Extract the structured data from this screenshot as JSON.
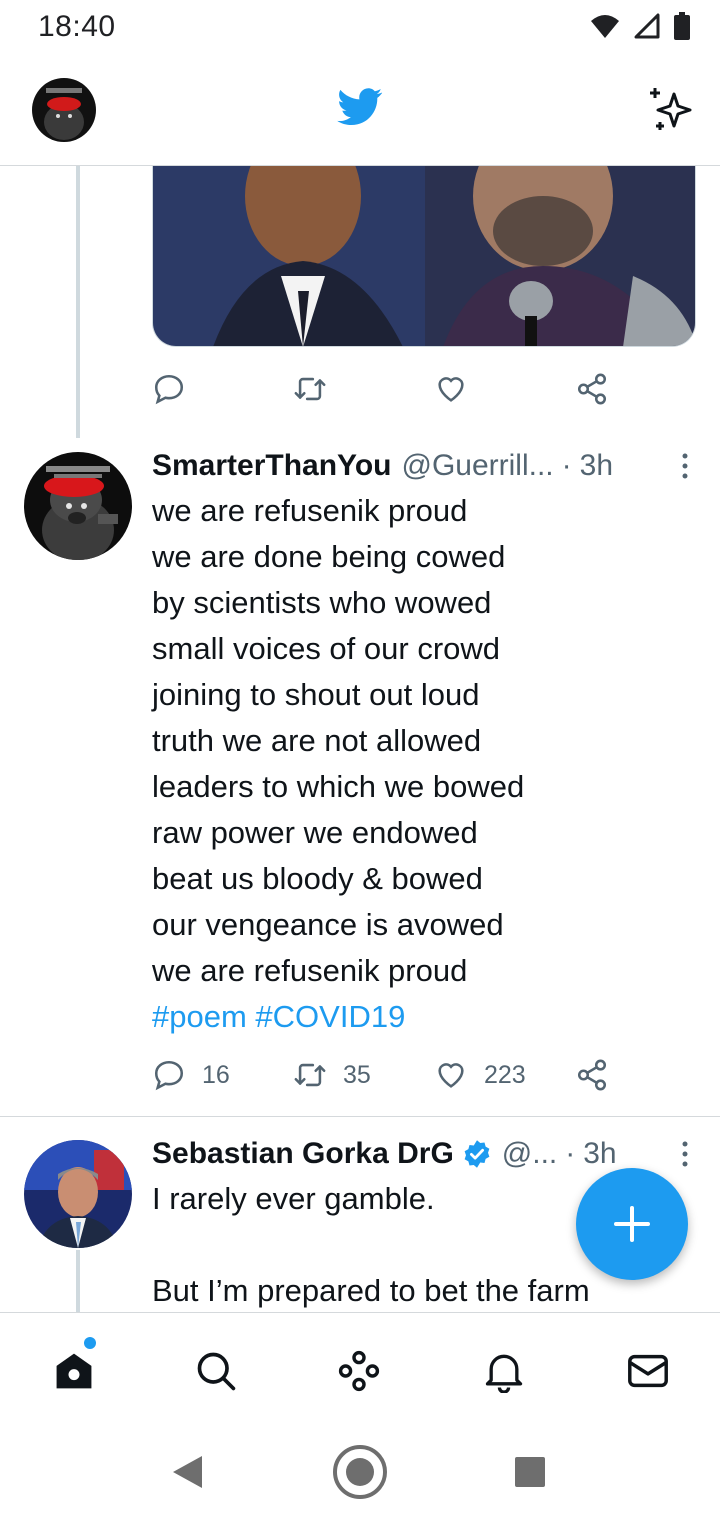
{
  "status_bar": {
    "time": "18:40",
    "icons": [
      "wifi-icon",
      "signal-icon",
      "battery-icon"
    ]
  },
  "header": {
    "logo": "twitter-bird-icon",
    "right_icon": "sparkle-icon"
  },
  "previous_tweet": {
    "actions": [
      "reply",
      "retweet",
      "like",
      "share"
    ]
  },
  "tweets": [
    {
      "name": "SmarterThanYou",
      "handle": "@Guerrill...",
      "dot": "·",
      "time": "3h",
      "lines": [
        "we are refusenik proud",
        "we are done being cowed",
        "by scientists who wowed",
        "small voices of our crowd",
        "joining to shout out loud",
        "truth we are not allowed",
        "leaders to which we bowed",
        "raw power we endowed",
        "beat us bloody & bowed",
        "our vengeance is avowed",
        "we are refusenik proud"
      ],
      "hashtags": [
        "#poem",
        "#COVID19"
      ],
      "counts": {
        "replies": "16",
        "retweets": "35",
        "likes": "223"
      }
    },
    {
      "name": "Sebastian Gorka DrG",
      "verified": true,
      "handle": "@...",
      "dot": "·",
      "time": "3h",
      "lines": [
        "I rarely ever gamble.",
        "",
        "But I’m prepared to bet the farm"
      ]
    }
  ],
  "bottom_nav": [
    "home",
    "search",
    "spaces",
    "notifications",
    "messages"
  ],
  "colors": {
    "accent": "#1d9bf0",
    "text": "#0f1419",
    "secondary": "#536471",
    "divider": "#d5d9dc"
  }
}
